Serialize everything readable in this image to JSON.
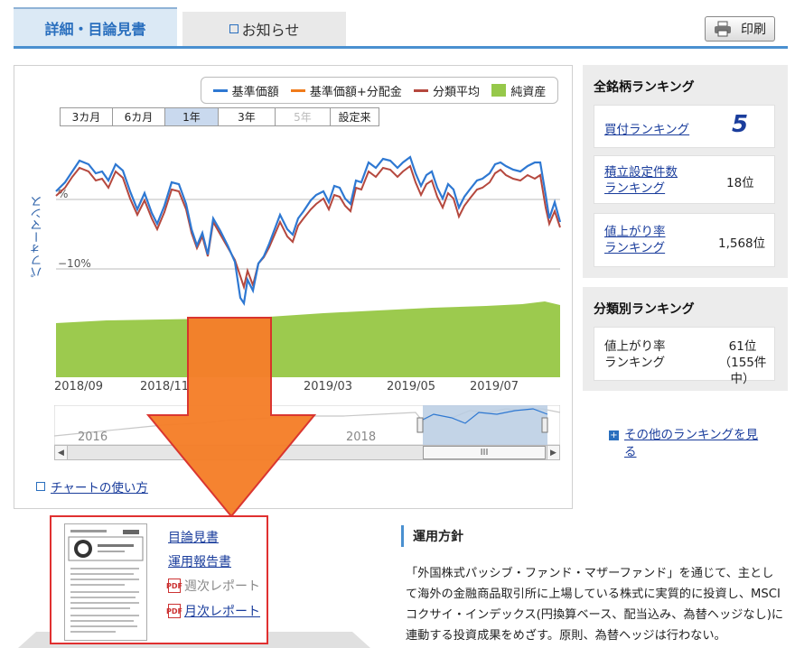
{
  "tabs": {
    "detail_label": "詳細・目論見書",
    "news_label": "お知らせ",
    "print_label": "印刷"
  },
  "chart": {
    "legend": [
      "基準価額",
      "基準価額+分配金",
      "分類平均",
      "純資産"
    ],
    "colors": {
      "nav": "#2e78d2",
      "nav_dist": "#f07b1a",
      "category": "#b5483e",
      "assets": "#96c84a"
    },
    "periods": [
      "3カ月",
      "6カ月",
      "1年",
      "3年",
      "5年",
      "設定来"
    ],
    "selected_period": "1年",
    "disabled_period": "5年",
    "y_title": "パフォーマンス",
    "y_labels": [
      "%",
      "−10%"
    ],
    "x_labels": [
      "2018/09",
      "2018/11",
      "2019/03",
      "2019/05",
      "2019/07"
    ],
    "nav_labels": [
      "2016",
      "2018"
    ],
    "scroll_label": "III",
    "how_to_link": "チャートの使い方"
  },
  "ranking": {
    "title": "全銘柄ランキング",
    "items": [
      {
        "label": "買付ランキング",
        "value": "5"
      },
      {
        "label": "積立設定件数ランキング",
        "label_lines": [
          "積立設定件数",
          "ランキング"
        ],
        "value": "18位"
      },
      {
        "label": "値上がり率ランキング",
        "label_lines": [
          "値上がり率",
          "ランキング"
        ],
        "value": "1,568位"
      }
    ]
  },
  "class_ranking": {
    "title": "分類別ランキング",
    "label_lines": [
      "値上がり率",
      "ランキング"
    ],
    "value": "61位",
    "sub_value": "（155件中）"
  },
  "other_ranking": {
    "lines": [
      "その他のランキングを見",
      "る"
    ]
  },
  "documents": {
    "prospectus": "目論見書",
    "report": "運用報告書",
    "weekly": "週次レポート",
    "monthly": "月次レポート"
  },
  "policy": {
    "heading": "運用方針",
    "text": "「外国株式パッシブ・ファンド・マザーファンド」を通じて、主として海外の金融商品取引所に上場している株式に実質的に投資し、MSCIコクサイ・インデックス(円換算ベース、配当込み、為替ヘッジなし)に連動する投資成果をめざす。原則、為替ヘッジは行わない。"
  }
}
